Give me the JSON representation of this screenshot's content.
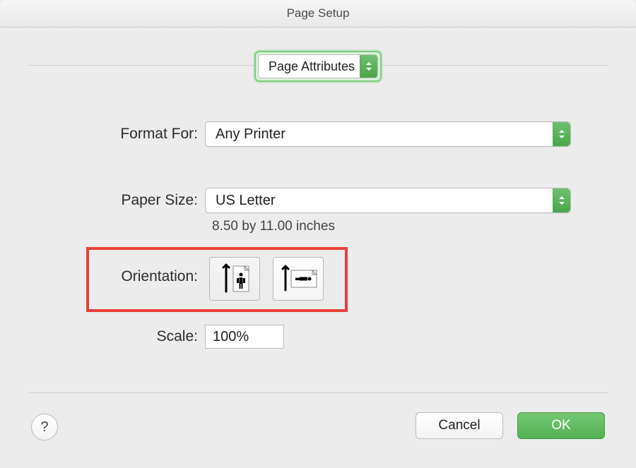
{
  "window": {
    "title": "Page Setup"
  },
  "section": {
    "selected": "Page Attributes"
  },
  "format_for": {
    "label": "Format For:",
    "value": "Any Printer"
  },
  "paper_size": {
    "label": "Paper Size:",
    "value": "US Letter",
    "note": "8.50 by 11.00 inches"
  },
  "orientation": {
    "label": "Orientation:"
  },
  "scale": {
    "label": "Scale:",
    "value": "100%"
  },
  "buttons": {
    "cancel": "Cancel",
    "ok": "OK"
  },
  "help": {
    "glyph": "?"
  },
  "colors": {
    "accent": "#5bb85b",
    "highlight": "#ec3f37"
  }
}
